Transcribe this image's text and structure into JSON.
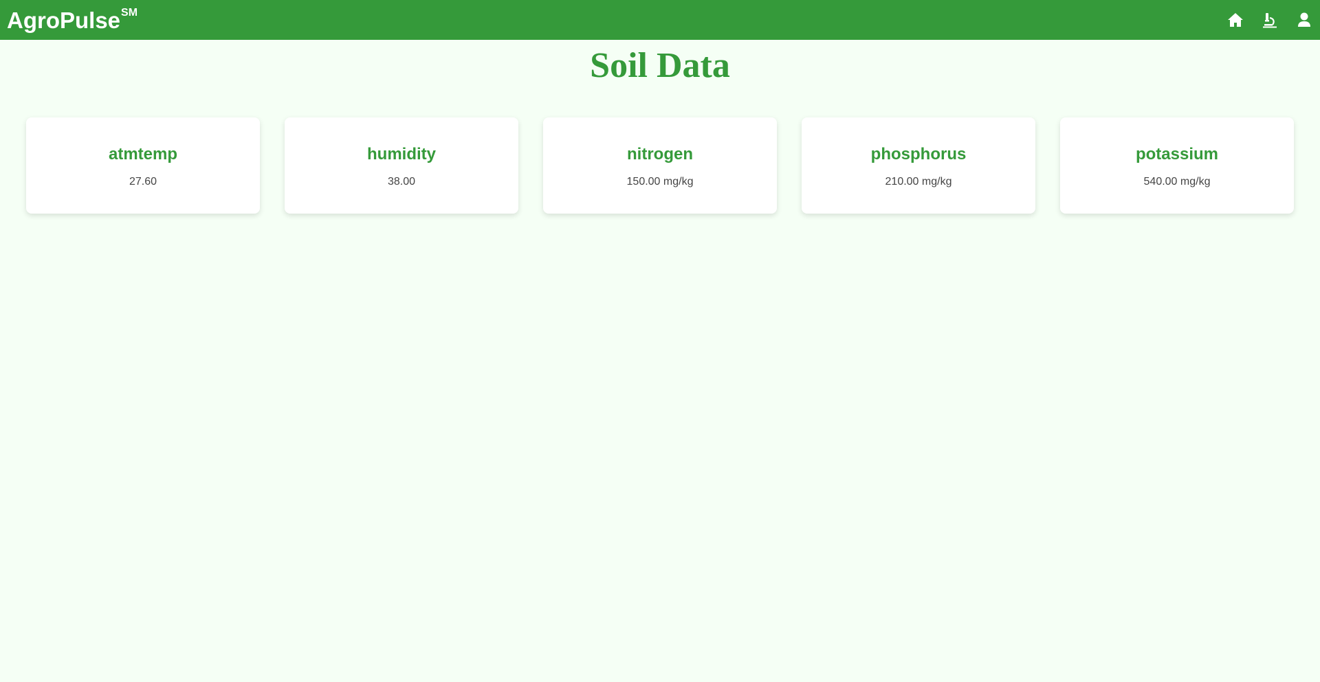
{
  "navbar": {
    "brand": "AgroPulse",
    "brand_mark": "SM",
    "background_color": "#359a3a",
    "icons": [
      "home-icon",
      "microscope-icon",
      "user-icon"
    ]
  },
  "page": {
    "title": "Soil Data",
    "accent_color": "#359a3a",
    "background_color": "#f5fff5"
  },
  "cards": [
    {
      "title": "atmtemp",
      "value": "27.60"
    },
    {
      "title": "humidity",
      "value": "38.00"
    },
    {
      "title": "nitrogen",
      "value": "150.00 mg/kg"
    },
    {
      "title": "phosphorus",
      "value": "210.00 mg/kg"
    },
    {
      "title": "potassium",
      "value": "540.00 mg/kg"
    }
  ]
}
